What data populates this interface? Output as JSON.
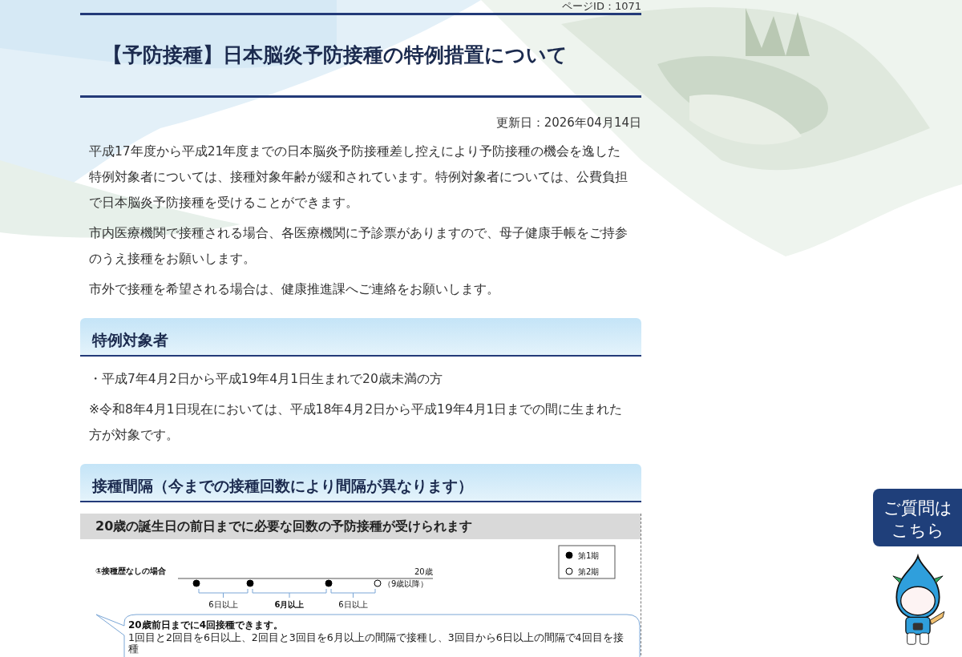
{
  "page_id": "ページID：1071",
  "title": "【予防接種】日本脳炎予防接種の特例措置について",
  "updated": "更新日：2026年04月14日",
  "intro": [
    "平成17年度から平成21年度までの日本脳炎予防接種差し控えにより予防接種の機会を逸した特例対象者については、接種対象年齢が緩和されています。特例対象者については、公費負担で日本脳炎予防接種を受けることができます。",
    "市内医療機関で接種される場合、各医療機関に予診票がありますので、母子健康手帳をご持参のうえ接種をお願いします。",
    "市外で接種を希望される場合は、健康推進課へご連絡をお願いします。"
  ],
  "sections": [
    {
      "heading": "特例対象者",
      "paragraphs": [
        "・平成7年4月2日から平成19年4月1日生まれで20歳未満の方",
        "※令和8年4月1日現在においては、平成18年4月2日から平成19年4月1日までの間に生まれた方が対象です。"
      ]
    },
    {
      "heading": "接種間隔（今までの接種回数により間隔が異なります）"
    }
  ],
  "figure": {
    "banner": "20歳の誕生日の前日までに必要な回数の予防接種が受けられます",
    "legend": [
      {
        "kind": "filled",
        "label": "第1期"
      },
      {
        "kind": "open",
        "label": "第2期"
      }
    ],
    "case_label": "①接種歴なしの場合",
    "end_label": "20歳",
    "doses": [
      {
        "kind": "filled"
      },
      {
        "kind": "filled"
      },
      {
        "kind": "filled"
      },
      {
        "kind": "open",
        "note": "（9歳以降）"
      }
    ],
    "intervals": [
      {
        "label": "6日以上",
        "bold": false
      },
      {
        "label": "6月以上",
        "bold": true
      },
      {
        "label": "6日以上",
        "bold": false
      }
    ],
    "callout": {
      "title": "20歳前日までに4回接種できます。",
      "text": "1回目と2回目を6日以上、2回目と3回目を6月以上の間隔で接種し、3回目から6日以上の間隔で4回目を接種"
    }
  },
  "help_bubble": [
    "ご質問は",
    "こちら"
  ]
}
